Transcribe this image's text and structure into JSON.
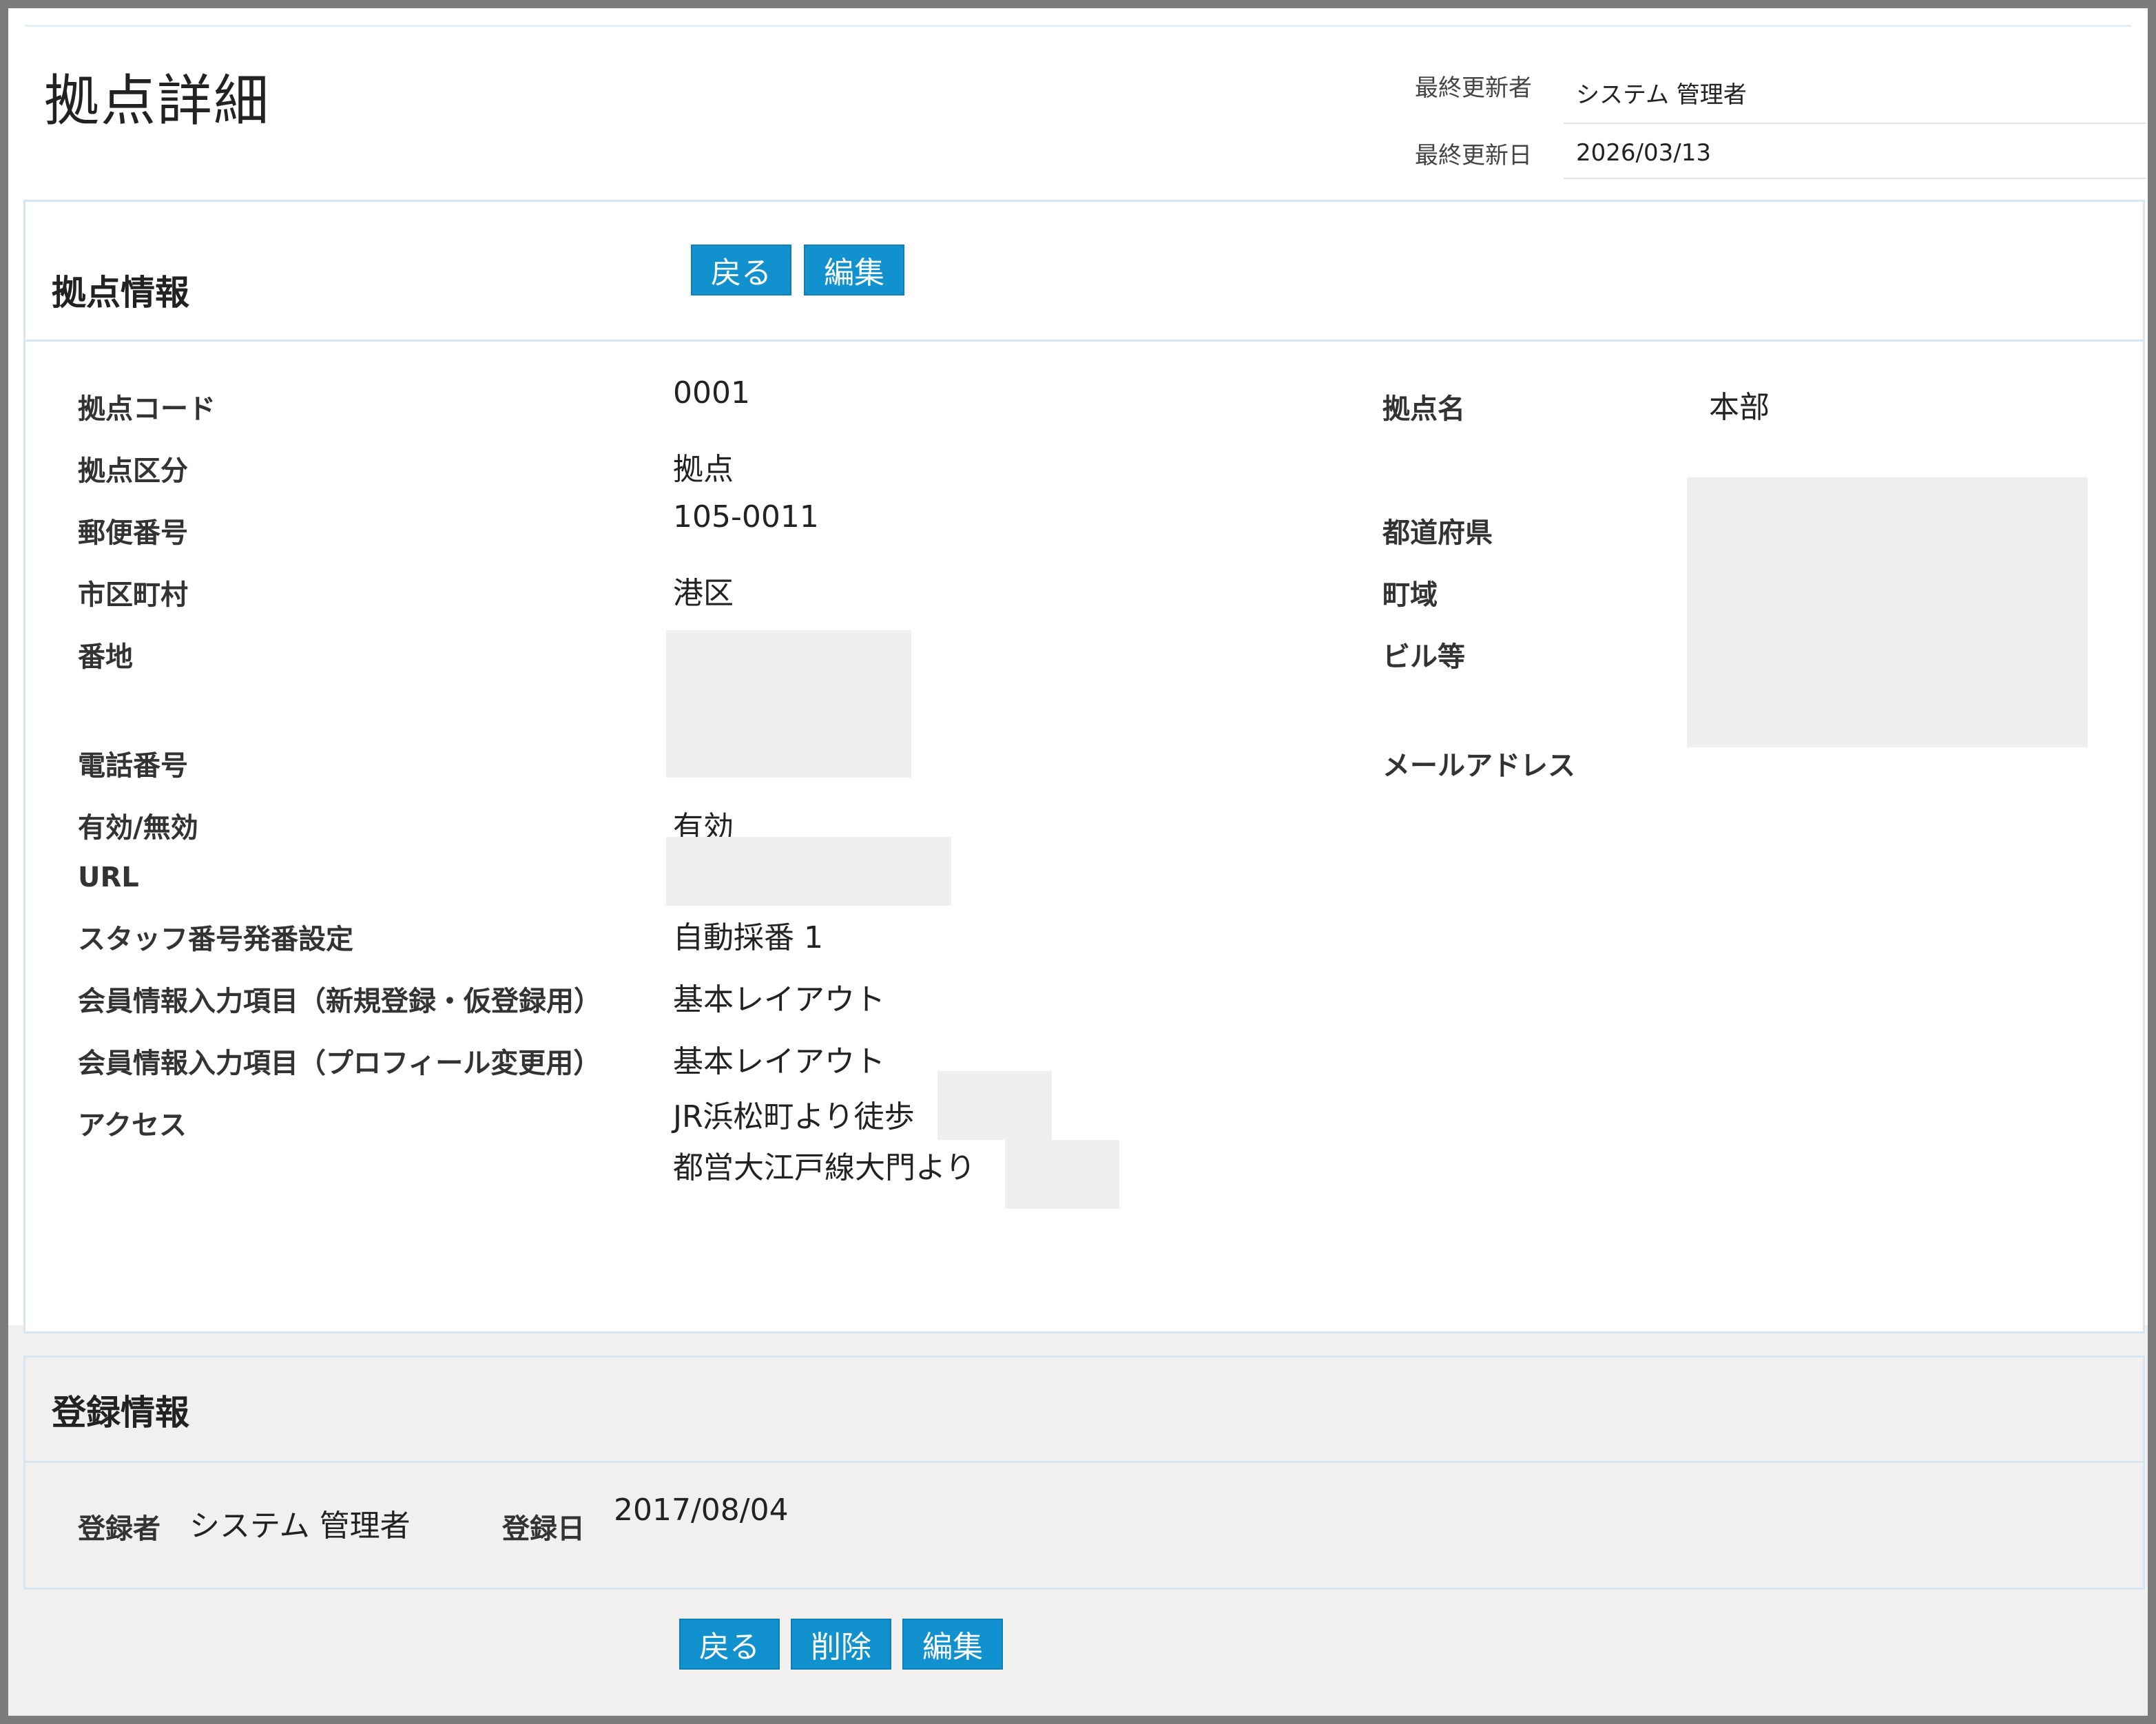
{
  "page": {
    "title": "拠点詳細",
    "last_updated_by_label": "最終更新者",
    "last_updated_by": "システム 管理者",
    "last_updated_date_label": "最終更新日",
    "last_updated_date": "2026/03/13"
  },
  "info_section": {
    "title": "拠点情報",
    "back_label": "戻る",
    "edit_label": "編集",
    "fields": {
      "code_label": "拠点コード",
      "code_value": "0001",
      "type_label": "拠点区分",
      "type_value": "拠点",
      "postal_label": "郵便番号",
      "postal_value": "105-0011",
      "city_label": "市区町村",
      "city_value": "港区",
      "address_label": "番地",
      "phone_label": "電話番号",
      "status_label": "有効/無効",
      "status_value": "有効",
      "url_label": "URL",
      "staff_number_label": "スタッフ番号発番設定",
      "staff_number_value": "自動採番 1",
      "member_new_label": "会員情報入力項目（新規登録・仮登録用）",
      "member_new_value": "基本レイアウト",
      "member_profile_label": "会員情報入力項目（プロフィール変更用）",
      "member_profile_value": "基本レイアウト",
      "access_label": "アクセス",
      "access_line1": "JR浜松町より徒歩",
      "access_line2": "都営大江戸線大門より",
      "name_label": "拠点名",
      "name_value": "本部",
      "prefecture_label": "都道府県",
      "town_label": "町域",
      "building_label": "ビル等",
      "email_label": "メールアドレス"
    }
  },
  "registration_section": {
    "title": "登録情報",
    "registrant_label": "登録者",
    "registrant_value": "システム 管理者",
    "date_label": "登録日",
    "date_value": "2017/08/04"
  },
  "footer_buttons": {
    "back_label": "戻る",
    "delete_label": "削除",
    "edit_label": "編集"
  },
  "colors": {
    "button_bg": "#1192cf",
    "panel_border": "#d6e6f3",
    "gray_bg": "#f1f0ee",
    "frame": "#7c7c7c"
  }
}
